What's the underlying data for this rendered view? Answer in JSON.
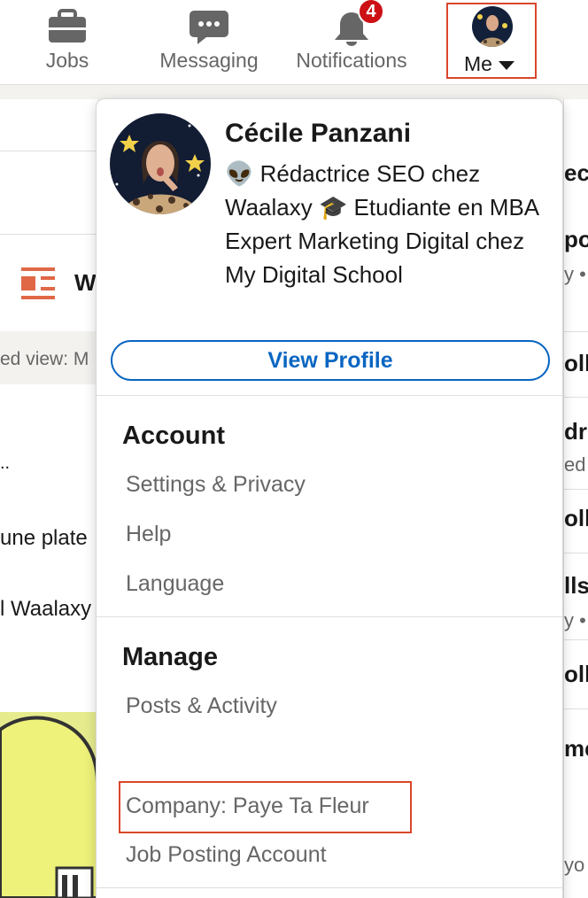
{
  "nav": {
    "jobs_label": "Jobs",
    "messaging_label": "Messaging",
    "notifications_label": "Notifications",
    "notifications_count": "4",
    "me_label": "Me"
  },
  "background": {
    "left_snippets": [
      "W",
      "ed view: M",
      "..",
      "une plate",
      "l Waalaxy"
    ],
    "right_snippets": [
      "ec",
      "po",
      "y •",
      "oll",
      "dr",
      "ed",
      "oll",
      "lls",
      "y •",
      "oll",
      "me",
      "yo"
    ]
  },
  "menu": {
    "profile": {
      "name": "Cécile Panzani",
      "headline": "👽 Rédactrice SEO chez Waalaxy 🎓 Etudiante en MBA Expert Marketing Digital chez My Digital School",
      "view_profile_label": "View Profile"
    },
    "account": {
      "title": "Account",
      "items": [
        "Settings & Privacy",
        "Help",
        "Language"
      ]
    },
    "manage": {
      "title": "Manage",
      "items": [
        "Posts & Activity",
        "Company: Paye Ta Fleur",
        "Job Posting Account"
      ]
    }
  },
  "colors": {
    "brand_blue": "#0a66c2",
    "badge_red": "#cc1016",
    "highlight_box": "#d9472b",
    "muted_text": "#666666"
  }
}
